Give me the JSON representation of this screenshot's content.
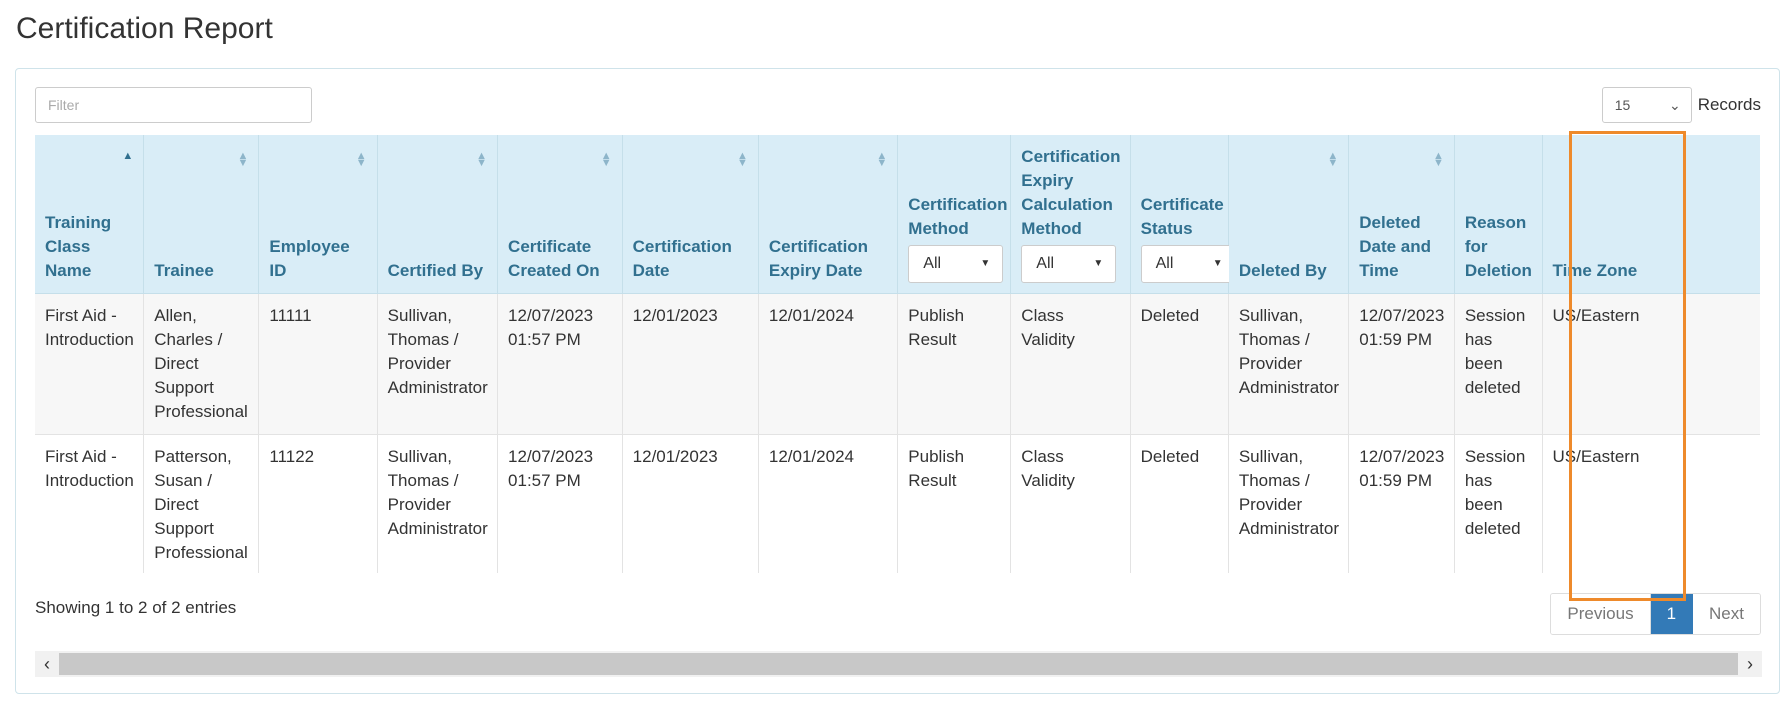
{
  "page": {
    "title": "Certification Report"
  },
  "toolbar": {
    "filter_placeholder": "Filter",
    "records_value": "15",
    "records_label": "Records"
  },
  "table": {
    "columns": [
      {
        "label": "Training Class Name",
        "sort": "asc"
      },
      {
        "label": "Trainee",
        "sort": "both"
      },
      {
        "label": "Employee ID",
        "sort": "both"
      },
      {
        "label": "Certified By",
        "sort": "both"
      },
      {
        "label": "Certificate Created On",
        "sort": "both"
      },
      {
        "label": "Certification Date",
        "sort": "both"
      },
      {
        "label": "Certification Expiry Date",
        "sort": "both"
      },
      {
        "label": "Certification Method",
        "filter": "All"
      },
      {
        "label": "Certification Expiry Calculation Method",
        "filter": "All"
      },
      {
        "label": "Certificate Status",
        "filter": "All"
      },
      {
        "label": "Deleted By",
        "sort": "both"
      },
      {
        "label": "Deleted Date and Time",
        "sort": "both"
      },
      {
        "label": "Reason for Deletion"
      },
      {
        "label": "Time Zone"
      }
    ],
    "rows": [
      [
        "First Aid - Introduction",
        "Allen, Charles / Direct Support Professional",
        "11111",
        "Sullivan, Thomas / Provider Administrator",
        "12/07/2023 01:57 PM",
        "12/01/2023",
        "12/01/2024",
        "Publish Result",
        "Class Validity",
        "Deleted",
        "Sullivan, Thomas / Provider Administrator",
        "12/07/2023 01:59 PM",
        "Session has been deleted",
        "US/Eastern"
      ],
      [
        "First Aid - Introduction",
        "Patterson, Susan / Direct Support Professional",
        "11122",
        "Sullivan, Thomas / Provider Administrator",
        "12/07/2023 01:57 PM",
        "12/01/2023",
        "12/01/2024",
        "Publish Result",
        "Class Validity",
        "Deleted",
        "Sullivan, Thomas / Provider Administrator",
        "12/07/2023 01:59 PM",
        "Session has been deleted",
        "US/Eastern"
      ]
    ]
  },
  "footer": {
    "entries_info": "Showing 1 to 2 of 2 entries",
    "pagination": {
      "previous": "Previous",
      "current": "1",
      "next": "Next"
    }
  },
  "colors": {
    "header_bg": "#d9edf7",
    "header_text": "#31708f",
    "highlight": "#ee8a2b",
    "active_page": "#337ab7"
  }
}
